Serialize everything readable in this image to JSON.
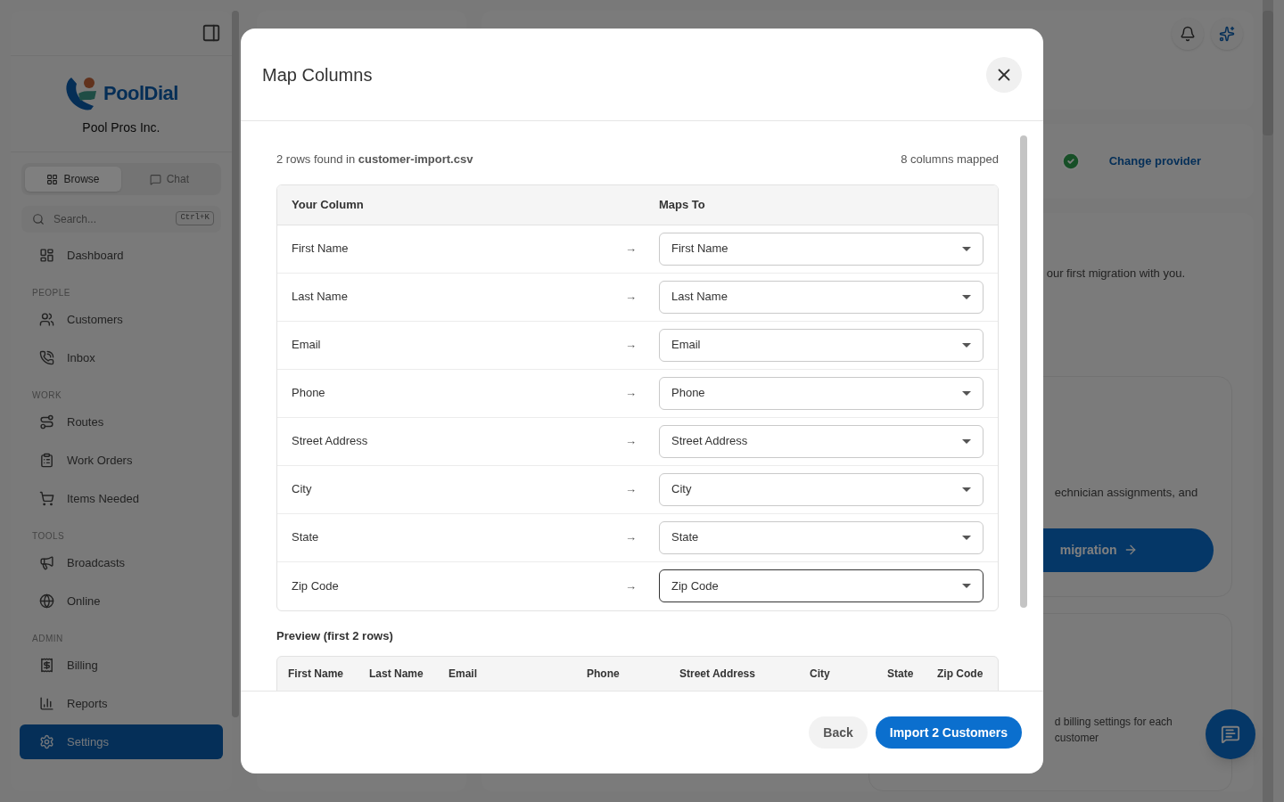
{
  "sidebar": {
    "brand": "PoolDial",
    "company": "Pool Pros Inc.",
    "tabs": [
      {
        "label": "Browse",
        "selected": true
      },
      {
        "label": "Chat",
        "selected": false
      }
    ],
    "search": {
      "placeholder": "Search...",
      "shortcut": "Ctrl+K"
    },
    "nav": [
      {
        "kind": "item",
        "label": "Dashboard",
        "selected": false
      },
      {
        "kind": "section",
        "label": "PEOPLE"
      },
      {
        "kind": "item",
        "label": "Customers",
        "selected": false
      },
      {
        "kind": "item",
        "label": "Inbox",
        "selected": false
      },
      {
        "kind": "section",
        "label": "WORK"
      },
      {
        "kind": "item",
        "label": "Routes",
        "selected": false
      },
      {
        "kind": "item",
        "label": "Work Orders",
        "selected": false
      },
      {
        "kind": "item",
        "label": "Items Needed",
        "selected": false
      },
      {
        "kind": "section",
        "label": "TOOLS"
      },
      {
        "kind": "item",
        "label": "Broadcasts",
        "selected": false
      },
      {
        "kind": "item",
        "label": "Online",
        "selected": false
      },
      {
        "kind": "section",
        "label": "ADMIN"
      },
      {
        "kind": "item",
        "label": "Billing",
        "selected": false
      },
      {
        "kind": "item",
        "label": "Reports",
        "selected": false
      },
      {
        "kind": "item",
        "label": "Settings",
        "selected": true
      }
    ]
  },
  "background": {
    "provider_link": "Change provider",
    "intro_text": "our first migration with you.",
    "card_text": "echnician assignments, and",
    "migration_button": "migration",
    "billing_text": "d billing settings for each customer"
  },
  "modal": {
    "title": "Map Columns",
    "summary": "2 rows found in **customer-import.csv**",
    "mapped_count": "8 columns mapped",
    "columns": [
      "Your Column",
      "Maps To"
    ],
    "mappings": [
      {
        "source": "First Name",
        "arrow": "→",
        "target": "First Name",
        "focused": false
      },
      {
        "source": "Last Name",
        "arrow": "→",
        "target": "Last Name",
        "focused": false
      },
      {
        "source": "Email",
        "arrow": "→",
        "target": "Email",
        "focused": false
      },
      {
        "source": "Phone",
        "arrow": "→",
        "target": "Phone",
        "focused": false
      },
      {
        "source": "Street Address",
        "arrow": "→",
        "target": "Street Address",
        "focused": false
      },
      {
        "source": "City",
        "arrow": "→",
        "target": "City",
        "focused": false
      },
      {
        "source": "State",
        "arrow": "→",
        "target": "State",
        "focused": false
      },
      {
        "source": "Zip Code",
        "arrow": "→",
        "target": "Zip Code",
        "focused": true
      }
    ],
    "preview_title": "Preview (first 2 rows)",
    "preview_columns": [
      "First Name",
      "Last Name",
      "Email",
      "Phone",
      "Street Address",
      "City",
      "State",
      "Zip Code"
    ],
    "buttons": [
      {
        "kind": "secondary",
        "label": "Back"
      },
      {
        "kind": "primary",
        "label": "Import 2 Customers"
      }
    ]
  }
}
